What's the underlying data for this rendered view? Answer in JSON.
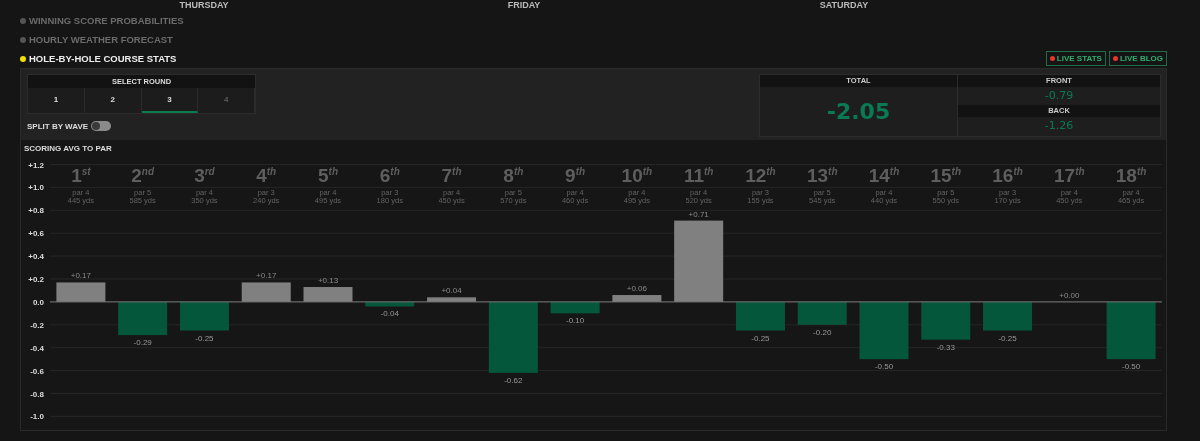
{
  "days": [
    "THURSDAY",
    "FRIDAY",
    "SATURDAY"
  ],
  "sections": [
    {
      "label": "WINNING SCORE PROBABILITIES",
      "selected": false
    },
    {
      "label": "HOURLY WEATHER FORECAST",
      "selected": false
    },
    {
      "label": "HOLE-BY-HOLE COURSE STATS",
      "selected": true
    }
  ],
  "live_links": [
    {
      "label": "LIVE STATS"
    },
    {
      "label": "LIVE BLOG"
    }
  ],
  "select_round": {
    "title": "SELECT ROUND",
    "rounds": [
      {
        "label": "1",
        "selected": false,
        "disabled": false
      },
      {
        "label": "2",
        "selected": false,
        "disabled": false
      },
      {
        "label": "3",
        "selected": true,
        "disabled": false
      },
      {
        "label": "4",
        "selected": false,
        "disabled": true
      }
    ]
  },
  "split_by_wave": {
    "label": "SPLIT BY WAVE",
    "on": false
  },
  "totals": {
    "total_label": "TOTAL",
    "total": "-2.05",
    "front_label": "FRONT",
    "front": "-0.79",
    "back_label": "BACK",
    "back": "-1.26"
  },
  "chart": {
    "title": "SCORING AVG TO PAR",
    "holes": [
      {
        "par": "par 4",
        "yards": "445 yds"
      },
      {
        "par": "par 5",
        "yards": "585 yds"
      },
      {
        "par": "par 4",
        "yards": "350 yds"
      },
      {
        "par": "par 3",
        "yards": "240 yds"
      },
      {
        "par": "par 4",
        "yards": "495 yds"
      },
      {
        "par": "par 3",
        "yards": "180 yds"
      },
      {
        "par": "par 4",
        "yards": "450 yds"
      },
      {
        "par": "par 5",
        "yards": "570 yds"
      },
      {
        "par": "par 4",
        "yards": "460 yds"
      },
      {
        "par": "par 4",
        "yards": "495 yds"
      },
      {
        "par": "par 4",
        "yards": "520 yds"
      },
      {
        "par": "par 3",
        "yards": "155 yds"
      },
      {
        "par": "par 5",
        "yards": "545 yds"
      },
      {
        "par": "par 4",
        "yards": "440 yds"
      },
      {
        "par": "par 5",
        "yards": "550 yds"
      },
      {
        "par": "par 3",
        "yards": "170 yds"
      },
      {
        "par": "par 4",
        "yards": "450 yds"
      },
      {
        "par": "par 4",
        "yards": "465 yds"
      }
    ],
    "chart_data": {
      "type": "bar",
      "categories": [
        "1$^{st}$",
        "2$^{nd}$",
        "3$^{rd}$",
        "4$^{th}$",
        "5$^{th}$",
        "6$^{th}$",
        "7$^{th}$",
        "8$^{th}$",
        "9$^{th}$",
        "10$^{th}$",
        "11$^{th}$",
        "12$^{th}$",
        "13$^{th}$",
        "14$^{th}$",
        "15$^{th}$",
        "16$^{th}$",
        "17$^{th}$",
        "18$^{th}$"
      ],
      "values": [
        0.17,
        -0.29,
        -0.25,
        0.17,
        0.13,
        -0.04,
        0.04,
        -0.62,
        -0.1,
        0.06,
        0.71,
        -0.25,
        -0.2,
        -0.5,
        -0.33,
        -0.25,
        0.0,
        -0.5
      ],
      "grid": true,
      "value_labels": [
        "+0.17",
        "-0.29",
        "-0.25",
        "+0.17",
        "+0.13",
        "-0.04",
        "+0.04",
        "-0.62",
        "-0.10",
        "+0.06",
        "+0.71",
        "-0.25",
        "-0.20",
        "-0.50",
        "-0.33",
        "-0.25",
        "+0.00",
        "-0.50"
      ],
      "ylim": [
        -1.0,
        1.2
      ],
      "yticks": [
        {
          "value": 1.2,
          "label": "+1.2"
        },
        {
          "value": 1.0,
          "label": "+1.0"
        },
        {
          "value": 0.8,
          "label": "+0.8"
        },
        {
          "value": 0.6,
          "label": "+0.6"
        },
        {
          "value": 0.4,
          "label": "+0.4"
        },
        {
          "value": 0.2,
          "label": "+0.2"
        },
        {
          "value": 0,
          "label": "0.0"
        },
        {
          "value": -0.2,
          "label": "-0.2"
        },
        {
          "value": -0.4,
          "label": "-0.4"
        },
        {
          "value": -0.6,
          "label": "-0.6"
        },
        {
          "value": -0.8,
          "label": "-0.8"
        },
        {
          "value": -1.0,
          "label": "-1.0"
        }
      ]
    }
  }
}
